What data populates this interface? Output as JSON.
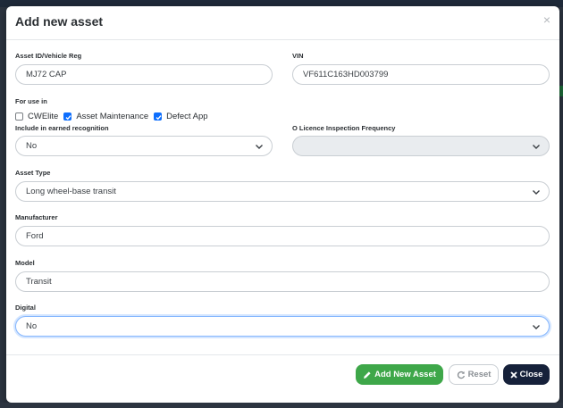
{
  "modal": {
    "title": "Add new asset",
    "close_glyph": "×"
  },
  "fields": {
    "asset_id": {
      "label": "Asset ID/Vehicle Reg",
      "value": "MJ72 CAP"
    },
    "vin": {
      "label": "VIN",
      "value": "VF611C163HD003799"
    },
    "for_use_in": {
      "label": "For use in",
      "options": [
        {
          "label": "CWElite",
          "checked": false
        },
        {
          "label": "Asset Maintenance",
          "checked": true
        },
        {
          "label": "Defect App",
          "checked": true
        }
      ]
    },
    "earned_recognition": {
      "label": "Include in earned recognition",
      "value": "No"
    },
    "o_licence": {
      "label": "O Licence Inspection Frequency",
      "value": ""
    },
    "asset_type": {
      "label": "Asset Type",
      "value": "Long wheel-base transit"
    },
    "manufacturer": {
      "label": "Manufacturer",
      "value": "Ford"
    },
    "model": {
      "label": "Model",
      "value": "Transit"
    },
    "digital": {
      "label": "Digital",
      "value": "No"
    }
  },
  "footer": {
    "add_label": "Add New Asset",
    "reset_label": "Reset",
    "close_label": "Close"
  },
  "colors": {
    "add_button": "#3ea749",
    "close_button": "#16213a",
    "checkbox_checked": "#0d6efd",
    "focus_border": "#86b7fe"
  }
}
